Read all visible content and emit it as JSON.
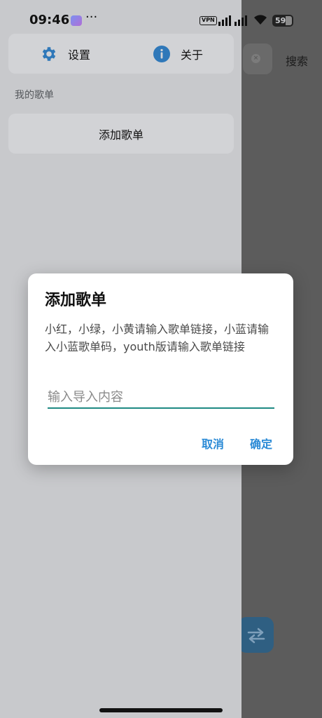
{
  "status_bar": {
    "time": "09:46",
    "dots": "···",
    "vpn": "VPN",
    "battery": "59"
  },
  "drawer": {
    "settings_label": "设置",
    "about_label": "关于",
    "section_label": "我的歌单",
    "add_playlist_label": "添加歌单"
  },
  "background": {
    "search_label": "搜索"
  },
  "dialog": {
    "title": "添加歌单",
    "message": "小红，小绿，小黄请输入歌单链接，小蓝请输入小蓝歌单码，youth版请输入歌单链接",
    "input_placeholder": "输入导入内容",
    "input_value": "",
    "cancel_label": "取消",
    "ok_label": "确定"
  },
  "colors": {
    "accent": "#2a8ad6",
    "input_underline": "#1f8a83",
    "fab": "#2f5f82"
  }
}
